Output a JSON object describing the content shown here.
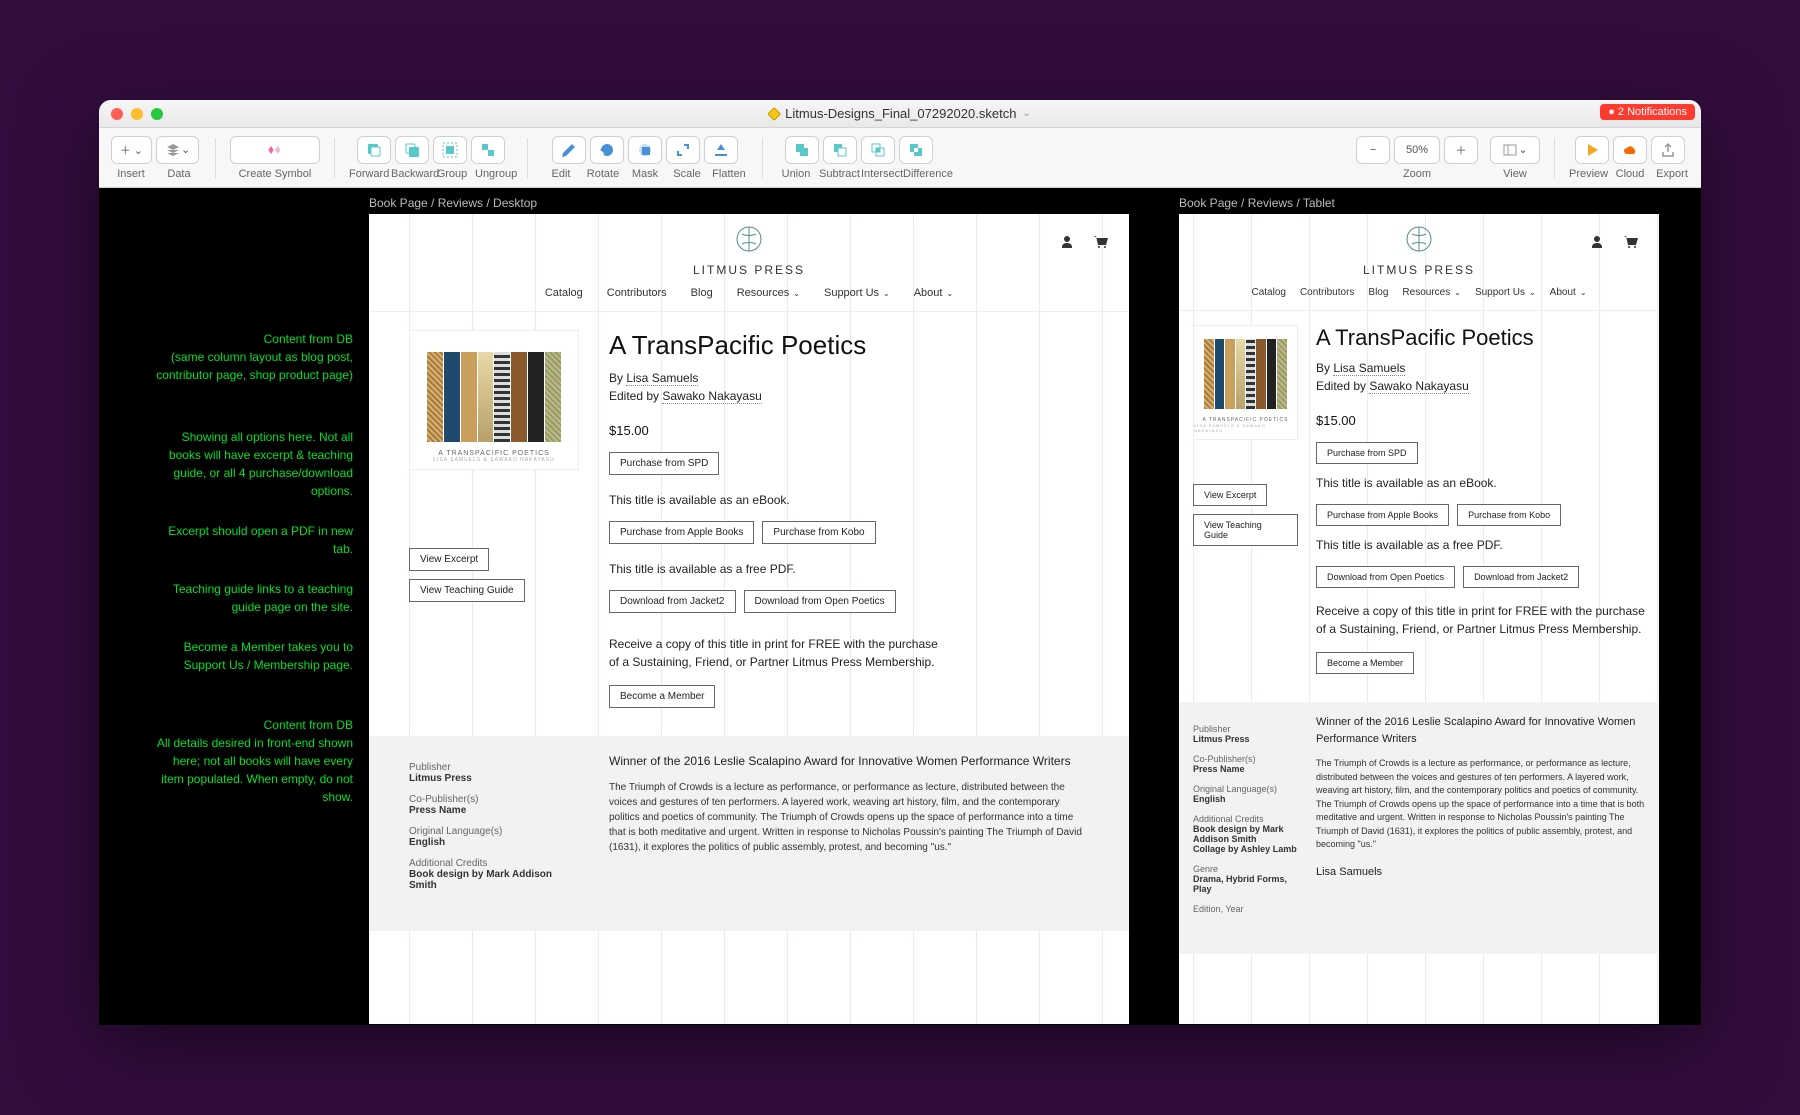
{
  "window": {
    "filename": "Litmus-Designs_Final_07292020.sketch",
    "notifications_label": "2 Notifications"
  },
  "toolbar": {
    "insert": "Insert",
    "data": "Data",
    "create_symbol": "Create Symbol",
    "forward": "Forward",
    "backward": "Backward",
    "group": "Group",
    "ungroup": "Ungroup",
    "edit": "Edit",
    "rotate": "Rotate",
    "mask": "Mask",
    "scale": "Scale",
    "flatten": "Flatten",
    "union": "Union",
    "subtract": "Subtract",
    "intersect": "Intersect",
    "difference": "Difference",
    "zoom": "Zoom",
    "zoom_value": "50%",
    "view": "View",
    "preview": "Preview",
    "cloud": "Cloud",
    "export": "Export"
  },
  "artboards": {
    "desktop_label": "Book Page / Reviews / Desktop",
    "tablet_label": "Book Page / Reviews / Tablet"
  },
  "annotations": {
    "a1_title": "Content from DB",
    "a1_body": "(same column layout as blog post, contributor page, shop product page)",
    "a2": "Showing all options here. Not all books will have excerpt & teaching guide, or all 4 purchase/download options.",
    "a3": "Excerpt should open a PDF in new tab.",
    "a4": "Teaching guide links to a teaching guide page on the site.",
    "a5": "Become a Member takes you to Support Us / Membership page.",
    "a6_title": "Content from DB",
    "a6_body": "All details desired in front-end shown here; not all books will have every item populated. When empty, do not show."
  },
  "site": {
    "brand": "LITMUS PRESS",
    "nav": {
      "catalog": "Catalog",
      "contributors": "Contributors",
      "blog": "Blog",
      "resources": "Resources",
      "support": "Support Us",
      "about": "About"
    },
    "book": {
      "title": "A TransPacific Poetics",
      "by_prefix": "By ",
      "author": "Lisa Samuels",
      "edited_prefix": "Edited by ",
      "editor": "Sawako Nakayasu",
      "price": "$15.00",
      "purchase_spd": "Purchase from SPD",
      "ebook_text": "This title is available as an eBook.",
      "purchase_apple": "Purchase from Apple Books",
      "purchase_kobo": "Purchase from Kobo",
      "pdf_text": "This title is available as a free PDF.",
      "download_jacket2": "Download from Jacket2",
      "download_openpoetics": "Download from Open Poetics",
      "member_text": "Receive a copy of this title in print for FREE with the purchase of a Sustaining, Friend, or Partner Litmus Press Membership.",
      "become_member": "Become a Member",
      "view_excerpt": "View Excerpt",
      "view_teaching": "View Teaching Guide",
      "cover_title": "A TRANSPACIFIC POETICS",
      "cover_sub": "LISA SAMUELS & SAWAKO NAKAYASU"
    },
    "meta": {
      "publisher_label": "Publisher",
      "publisher": "Litmus Press",
      "copub_label": "Co-Publisher(s)",
      "copub": "Press Name",
      "lang_label": "Original Language(s)",
      "lang": "English",
      "credits_label": "Additional Credits",
      "credits": "Book design by Mark Addison Smith",
      "credits2": "Collage by Ashley Lamb",
      "genre_label": "Genre",
      "genre": "Drama, Hybrid Forms, Play",
      "edition_label": "Edition, Year"
    },
    "award": "Winner of the 2016 Leslie Scalapino Award for Innovative Women Performance Writers",
    "body": "The Triumph of Crowds is a lecture as performance, or performance as lecture, distributed between the voices and gestures of ten performers. A layered work, weaving art history, film, and the contemporary politics and poetics of community. The Triumph of Crowds opens up the space of performance into a time that is both meditative and urgent. Written in response to Nicholas Poussin's painting The Triumph of David (1631), it explores the politics of public assembly, protest, and becoming \"us.\"",
    "contributor": "Lisa Samuels"
  }
}
